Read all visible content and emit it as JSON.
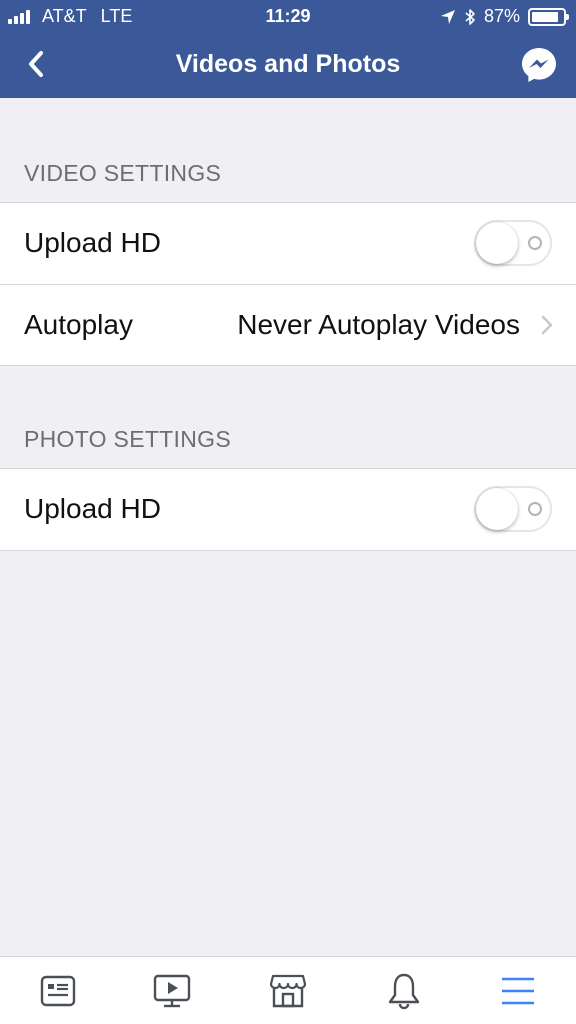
{
  "status_bar": {
    "carrier": "AT&T",
    "network": "LTE",
    "time": "11:29",
    "battery_percent": "87%",
    "battery_level": 0.87,
    "icons": [
      "signal-icon",
      "location-arrow-icon",
      "bluetooth-icon",
      "battery-icon"
    ]
  },
  "navbar": {
    "title": "Videos and Photos",
    "back_icon": "chevron-left-icon",
    "right_icon": "messenger-icon"
  },
  "video_settings": {
    "header": "VIDEO SETTINGS",
    "upload_hd": {
      "label": "Upload HD",
      "enabled": false
    },
    "autoplay": {
      "label": "Autoplay",
      "value": "Never Autoplay Videos"
    }
  },
  "photo_settings": {
    "header": "PHOTO SETTINGS",
    "upload_hd": {
      "label": "Upload HD",
      "enabled": false
    }
  },
  "tabbar": {
    "items": [
      {
        "icon": "news-feed-icon",
        "active": false
      },
      {
        "icon": "video-icon",
        "active": false
      },
      {
        "icon": "marketplace-icon",
        "active": false
      },
      {
        "icon": "notifications-bell-icon",
        "active": false
      },
      {
        "icon": "menu-icon",
        "active": true
      }
    ]
  },
  "colors": {
    "brand_blue": "#3b5998",
    "background": "#efeff4",
    "separator": "#d6d6da",
    "section_header": "#6d6d72",
    "tab_icon": "#4b4f56",
    "tab_active": "#4080ff"
  }
}
